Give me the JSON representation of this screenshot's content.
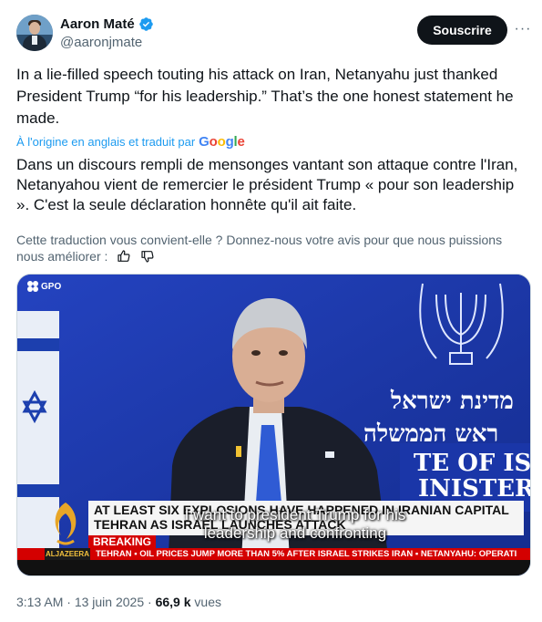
{
  "author": {
    "display_name": "Aaron Maté",
    "handle": "@aaronjmate",
    "verified": true,
    "verified_color": "#1d9bf0"
  },
  "actions": {
    "subscribe_label": "Souscrire",
    "more_label": "···"
  },
  "tweet": {
    "text": "In a lie-filled speech touting his attack on Iran, Netanyahu just thanked President Trump “for his leadership.” That’s the one honest statement he made."
  },
  "translation": {
    "attribution": "À l'origine en anglais et traduit par",
    "google_logo": [
      "G",
      "o",
      "o",
      "g",
      "l",
      "e"
    ],
    "text": "Dans un discours rempli de mensonges vantant son attaque contre l'Iran, Netanyahou vient de remercier le président Trump « pour son leadership ». C'est la seule déclaration honnête qu'il ait faite.",
    "feedback_prompt": "Cette traduction vous convient-elle ? Donnez-nous votre avis pour que nous puissions nous améliorer :"
  },
  "media": {
    "gpo_label": "GPO",
    "backdrop_hebrew_line1": "מדינת ישראל",
    "backdrop_hebrew_line2": "ראש הממשלה",
    "podium_line1": "TE OF ISRA",
    "podium_line2": "INISTER'S",
    "headline": "AT LEAST SIX EXPLOSIONS HAVE HAPPENED IN IRANIAN CAPITAL TEHRAN AS ISRAEL LAUNCHES ATTACK",
    "subtitle": "I want to president Trump for his leadership and confronting",
    "breaking_label": "BREAKING",
    "ticker": "TEHRAN  ▪  OIL PRICES JUMP MORE THAN 5% AFTER ISRAEL STRIKES IRAN  ▪  NETANYAHU: OPERATI",
    "channel_label": "ALJAZEERA",
    "backdrop_color": "#1a36a8",
    "ticker_color": "#d40000"
  },
  "meta": {
    "time": "3:13 AM",
    "separator": " · ",
    "date": "13 juin 2025",
    "views_count": "66,9 k",
    "views_label": " vues"
  }
}
